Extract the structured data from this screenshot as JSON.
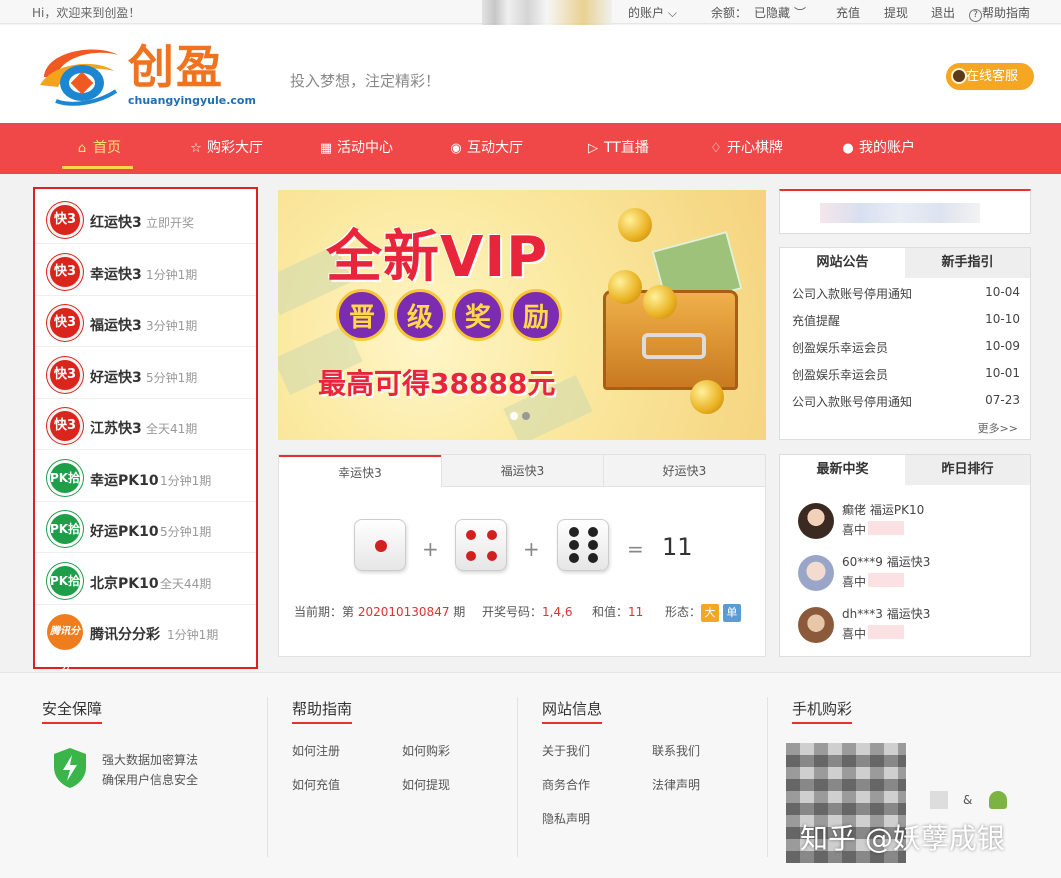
{
  "topbar": {
    "welcome": "Hi，欢迎来到创盈！",
    "account": "的账户",
    "balance_label": "余额：",
    "balance_value": "已隐藏",
    "recharge": "充值",
    "withdraw": "提现",
    "logout": "退出",
    "help": "帮助指南"
  },
  "header": {
    "logo_cn": "创盈",
    "logo_en": "chuangyingyule.com",
    "slogan": "投入梦想，注定精彩！",
    "service": "在线客服"
  },
  "nav": [
    {
      "label": "首页",
      "icon": "home-icon"
    },
    {
      "label": "购彩大厅",
      "icon": "star-icon"
    },
    {
      "label": "活动中心",
      "icon": "gift-icon"
    },
    {
      "label": "互动大厅",
      "icon": "broadcast-icon"
    },
    {
      "label": "TT直播",
      "icon": "play-icon"
    },
    {
      "label": "开心棋牌",
      "icon": "shield-icon"
    },
    {
      "label": "我的账户",
      "icon": "user-icon"
    }
  ],
  "lotteries": [
    {
      "name": "红运快3",
      "desc": "立即开奖",
      "badge": "快3",
      "kind": "k3"
    },
    {
      "name": "幸运快3",
      "desc": "1分钟1期",
      "badge": "快3",
      "kind": "k3"
    },
    {
      "name": "福运快3",
      "desc": "3分钟1期",
      "badge": "快3",
      "kind": "k3"
    },
    {
      "name": "好运快3",
      "desc": "5分钟1期",
      "badge": "快3",
      "kind": "k3"
    },
    {
      "name": "江苏快3",
      "desc": "全天41期",
      "badge": "快3",
      "kind": "k3"
    },
    {
      "name": "幸运PK10",
      "desc": "1分钟1期",
      "badge": "PK拾",
      "kind": "pk"
    },
    {
      "name": "好运PK10",
      "desc": "5分钟1期",
      "badge": "PK拾",
      "kind": "pk"
    },
    {
      "name": "北京PK10",
      "desc": "全天44期",
      "badge": "PK拾",
      "kind": "pk"
    },
    {
      "name": "腾讯分分彩",
      "desc": "1分钟1期",
      "badge": "腾讯分分",
      "kind": "txff"
    }
  ],
  "banner": {
    "headline": "全新VIP",
    "badge_chars": [
      "晋",
      "级",
      "奖",
      "励"
    ],
    "max_win": "最高可得38888元",
    "slide_index": 1,
    "slide_count": 2
  },
  "draw": {
    "tabs": [
      "幸运快3",
      "福运快3",
      "好运快3"
    ],
    "dice": [
      1,
      4,
      6
    ],
    "plus": "+",
    "equals": "=",
    "sum": "11",
    "period_label": "当前期：第",
    "period_value": "202010130847",
    "period_suffix": "期",
    "numbers_label": "开奖号码：",
    "numbers_value": "1,4,6",
    "sum_label": "和值：",
    "sum_value": "11",
    "shape_label": "形态：",
    "shape_big": "大",
    "shape_odd": "单"
  },
  "notice": {
    "tabs": [
      "网站公告",
      "新手指引"
    ],
    "items": [
      {
        "title": "公司入款账号停用通知",
        "date": "10-04"
      },
      {
        "title": "充值提醒",
        "date": "10-10"
      },
      {
        "title": "创盈娱乐幸运会员",
        "date": "10-09"
      },
      {
        "title": "创盈娱乐幸运会员",
        "date": "10-01"
      },
      {
        "title": "公司入款账号停用通知",
        "date": "07-23"
      }
    ],
    "more": "更多>>"
  },
  "winners": {
    "tabs": [
      "最新中奖",
      "昨日排行"
    ],
    "items": [
      {
        "user": "癫佬",
        "game": "福运PK10",
        "won": "喜中"
      },
      {
        "user": "60***9",
        "game": "福运快3",
        "won": "喜中"
      },
      {
        "user": "dh***3",
        "game": "福运快3",
        "won": "喜中"
      }
    ]
  },
  "footer": {
    "security": {
      "title": "安全保障",
      "line1": "强大数据加密算法",
      "line2": "确保用户信息安全"
    },
    "help": {
      "title": "帮助指南",
      "links": [
        "如何注册",
        "如何购彩",
        "如何充值",
        "如何提现"
      ]
    },
    "site": {
      "title": "网站信息",
      "links": [
        "关于我们",
        "联系我们",
        "商务合作",
        "法律声明",
        "隐私声明"
      ]
    },
    "mobile": {
      "title": "手机购彩",
      "amp": "&"
    },
    "watermark": "知乎 @妖孽成银"
  },
  "colors": {
    "accent": "#f04848",
    "orange": "#f5a623",
    "green": "#1e9e48",
    "blue": "#5b9bd5"
  }
}
